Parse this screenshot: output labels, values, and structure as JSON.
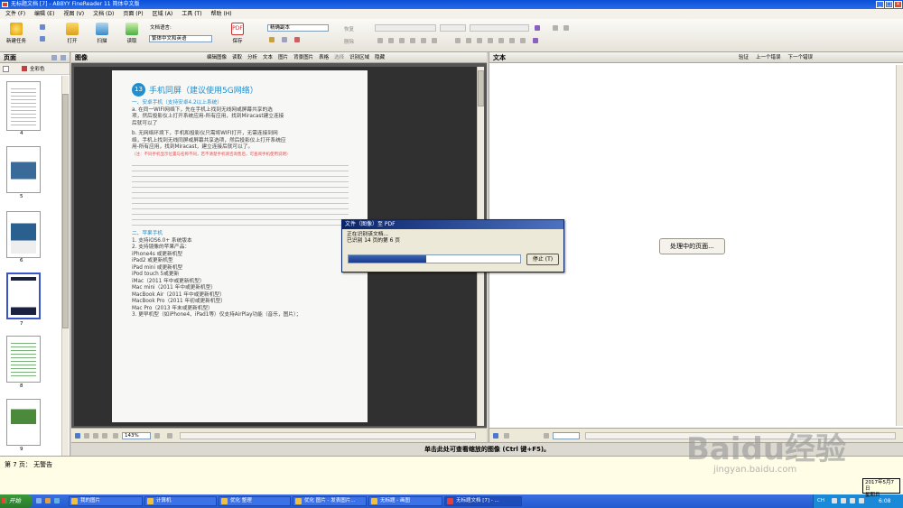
{
  "window": {
    "title": "无标题文档 [7] - ABBYY FineReader 11 简体中文版"
  },
  "menu": [
    "文件 (F)",
    "编辑 (E)",
    "视图 (V)",
    "文档 (D)",
    "页面 (P)",
    "区域 (A)",
    "工具 (T)",
    "帮助 (H)"
  ],
  "toolbar": {
    "new_task": "新建任务",
    "open": "打开",
    "scan": "扫描",
    "read": "读取",
    "doc_language_label": "文档语言:",
    "doc_language_value": "繁体中文和英语",
    "save": "保存",
    "save_format": "精确副本",
    "restore": "恢复",
    "delete": "删除"
  },
  "pages_panel": {
    "title": "页面",
    "color_mode": "全彩色",
    "thumbs": [
      {
        "label": "4"
      },
      {
        "label": "5"
      },
      {
        "label": "6"
      },
      {
        "label": "7"
      },
      {
        "label": "8"
      },
      {
        "label": "9"
      }
    ]
  },
  "image_panel": {
    "title": "图像",
    "tools": [
      "编辑图像",
      "读取",
      "分析",
      "文本",
      "图片",
      "背景图片",
      "表格",
      "选择",
      "识别区域",
      "隐藏"
    ],
    "zoom": "143%"
  },
  "document": {
    "number": "13",
    "heading": "手机同屏（建议使用5G网络）",
    "android_heading": "一、安卓手机（支持安卓4.2以上系统）",
    "para_a": [
      "a.  在同一WIFI网络下，先在手机上找到无线网或屏幕共享的选",
      "项，然后投影仪上打开系统应用-所有应用，找到Miracast建立连接",
      "后就可以了"
    ],
    "para_b": [
      "b.  无网络环境下，手机和投影仪只需将WIFI打开，无需连接到网",
      "络，手机上找到无线同屏或屏幕共享选项，然后投影仪上打开系统应",
      "用-所有应用，找到Miracast，建立连接后就可以了。"
    ],
    "note": "（注：不同手机显示位置与名称不同，若不清楚手机请咨询售后，可查阅手机使用说明）",
    "apple_heading": "二、苹果手机",
    "apple_lines": [
      "1. 支持iOS6.0+ 系统版本",
      "2. 支持镜像的苹果产品：",
      "iPhone4s 或更新机型",
      "iPad2 或更新机型",
      "iPad mini 或更新机型",
      "iPod touch 5或更新",
      "iMac（2011 年中或更新机型）",
      "Mac mini（2011 年中或更新机型）",
      "MacBook Air（2011 年中或更新机型）",
      "MacBook Pro（2011 年初或更新机型）",
      "Mac Pro（2013 年末或更新机型）",
      "3. 更早机型（如iPhone4、iPad1等）仅支持AirPlay功能（音乐，图片）；"
    ]
  },
  "text_panel": {
    "title": "文本",
    "verify": "验证",
    "prev_error": "上一个错误",
    "next_error": "下一个错误",
    "processing": "处理中的页面..."
  },
  "dialog": {
    "title": "文件（图像）至 PDF",
    "line1": "正在识别该文档...",
    "line2": "已识别 14 页的第 6 页",
    "stop": "停止 (T)",
    "progress": 0.45
  },
  "zoom_hint": "单击此处可查看缩放的图像 (Ctrl 键+F5)。",
  "status": "第 7 页： 无警告",
  "taskbar": {
    "start": "开始",
    "tasks": [
      "我的图片",
      "计算机",
      "优化  整理",
      "优化  图片 - 发表图片...",
      "无标题 - 画图",
      "无标题文档 [7] - ..."
    ],
    "lang": "CH",
    "time": "6:08",
    "date": "2017年5月7日",
    "weekday": "星期日"
  },
  "watermark": {
    "brand": "Baidu经验",
    "url": "jingyan.baidu.com"
  }
}
